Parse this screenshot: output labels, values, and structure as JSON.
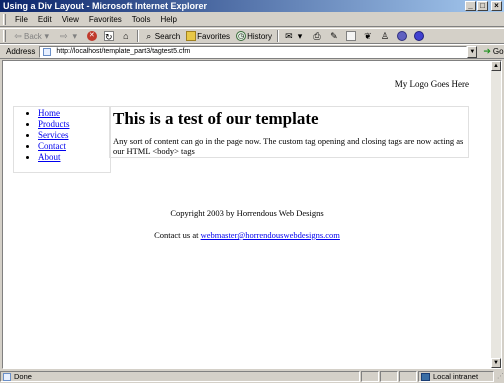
{
  "window": {
    "title": "Using a Div Layout - Microsoft Internet Explorer",
    "buttons": {
      "minimize": "_",
      "maximize": "□",
      "close": "×"
    }
  },
  "menubar": {
    "items": [
      {
        "label": "File"
      },
      {
        "label": "Edit"
      },
      {
        "label": "View"
      },
      {
        "label": "Favorites"
      },
      {
        "label": "Tools"
      },
      {
        "label": "Help"
      }
    ]
  },
  "toolbar": {
    "back_label": "Back",
    "search_label": "Search",
    "favorites_label": "Favorites",
    "history_label": "History"
  },
  "addressbar": {
    "label": "Address",
    "url": "http://localhost/template_part3/tagtest5.cfm",
    "go_label": "Go"
  },
  "page": {
    "logo_text": "My Logo Goes Here",
    "nav": [
      {
        "label": "Home"
      },
      {
        "label": "Products"
      },
      {
        "label": "Services"
      },
      {
        "label": "Contact"
      },
      {
        "label": "About"
      }
    ],
    "heading": "This is a test of our template",
    "body_text": "Any sort of content can go in the page now. The custom tag opening and closing tags are now acting as our HTML <body> tags",
    "copyright": "Copyright 2003 by Horrendous Web Designs",
    "contact_prefix": "Contact us at ",
    "contact_email": "webmaster@horrendouswebdesigns.com"
  },
  "statusbar": {
    "status": "Done",
    "zone": "Local intranet"
  },
  "colors": {
    "titlebar_start": "#0a246a",
    "titlebar_end": "#a6caf0",
    "chrome": "#d4d0c8",
    "link": "#0000ee"
  }
}
